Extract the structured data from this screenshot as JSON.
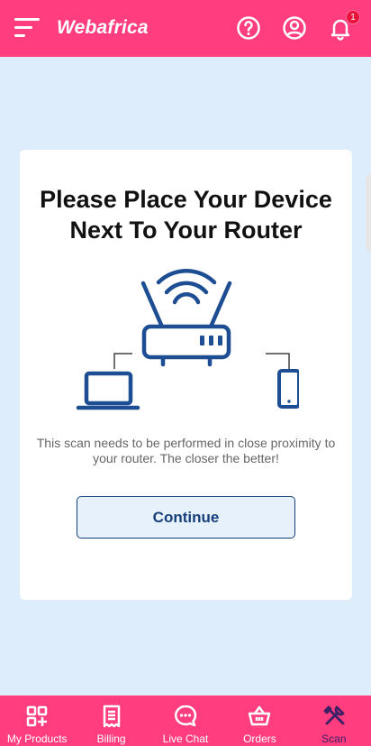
{
  "header": {
    "logo_text": "Webafrica",
    "notification_count": "1"
  },
  "card": {
    "title": "Please Place Your Device\nNext To Your Router",
    "description": "This scan needs to be performed in close proximity to your router. The closer the better!",
    "continue_label": "Continue"
  },
  "bottom_nav": {
    "items": [
      {
        "label": "My Products",
        "icon": "grid-plus-icon",
        "active": false
      },
      {
        "label": "Billing",
        "icon": "invoice-icon",
        "active": false
      },
      {
        "label": "Live Chat",
        "icon": "chat-bubble-icon",
        "active": false
      },
      {
        "label": "Orders",
        "icon": "basket-icon",
        "active": false
      },
      {
        "label": "Scan",
        "icon": "tools-icon",
        "active": true
      }
    ]
  },
  "colors": {
    "brand": "#ff3d7f",
    "background": "#deedfc",
    "primary_dark": "#163e78",
    "active_nav": "#3d1f66"
  }
}
